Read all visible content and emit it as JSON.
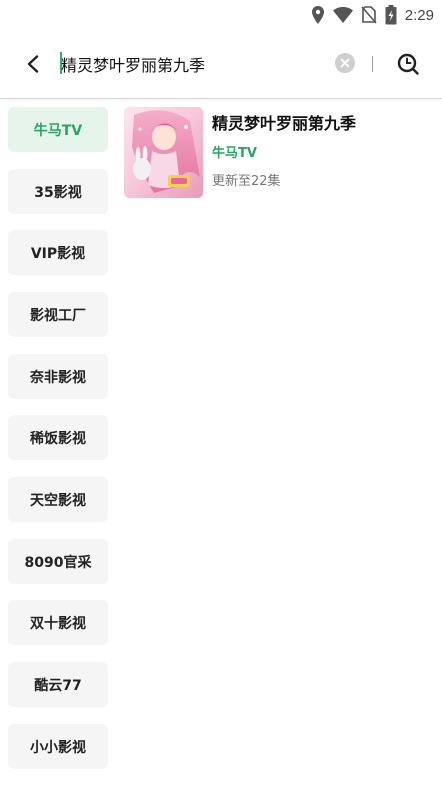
{
  "status_bar": {
    "time": "2:29",
    "icons": [
      "location-icon",
      "wifi-icon",
      "no-sim-icon",
      "battery-charging-icon"
    ]
  },
  "search": {
    "query": "精灵梦叶罗丽第九季",
    "icons": {
      "back": "back-arrow-icon",
      "clear": "clear-icon",
      "search": "search-icon"
    }
  },
  "sources": [
    {
      "label": "牛马TV",
      "active": true
    },
    {
      "label": "35影视",
      "active": false
    },
    {
      "label": "VIP影视",
      "active": false
    },
    {
      "label": "影视工厂",
      "active": false
    },
    {
      "label": "奈非影视",
      "active": false
    },
    {
      "label": "稀饭影视",
      "active": false
    },
    {
      "label": "天空影视",
      "active": false
    },
    {
      "label": "8090官采",
      "active": false
    },
    {
      "label": "双十影视",
      "active": false
    },
    {
      "label": "酷云77",
      "active": false
    },
    {
      "label": "小小影视",
      "active": false
    }
  ],
  "results": [
    {
      "title": "精灵梦叶罗丽第九季",
      "source": "牛马TV",
      "episodes": "更新至22集"
    }
  ],
  "colors": {
    "accent": "#2aa463",
    "accent_bg": "#e6f4ec",
    "item_bg": "#f5f5f5"
  }
}
